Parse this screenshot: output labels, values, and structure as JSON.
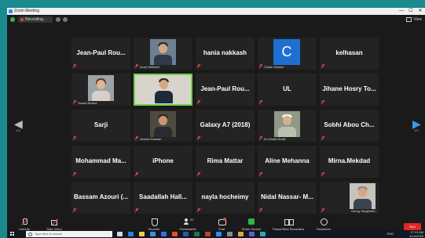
{
  "window": {
    "title": "Zoom Meeting",
    "controls": [
      "—",
      "☐",
      "✕"
    ]
  },
  "topbar": {
    "recording_label": "Recording...",
    "view_label": "View"
  },
  "pagination": {
    "left": "1/2",
    "right": "1/2"
  },
  "tiles": [
    {
      "name": "Jean-Paul Rou...",
      "mic_muted": true
    },
    {
      "name": "",
      "sub_label": "Imad Hbtbeiht",
      "type": "photo",
      "mic_muted": true
    },
    {
      "name": "hania nakkash",
      "mic_muted": true
    },
    {
      "name": "",
      "sub_label": "Chafic Mokbel",
      "type": "avatar",
      "avatar_letter": "C",
      "avatar_color": "#1f6fd1",
      "mic_muted": true
    },
    {
      "name": "kelhasan",
      "mic_muted": true
    },
    {
      "name": "",
      "sub_label": "Souad Nouna",
      "type": "photo",
      "mic_muted": true
    },
    {
      "name": "",
      "sub_label": "Ibra Dahan",
      "type": "photo",
      "active_speaker": true,
      "mic_muted": false
    },
    {
      "name": "Jean-Paul Rou...",
      "mic_muted": true
    },
    {
      "name": "UL",
      "mic_muted": true
    },
    {
      "name": "Jihane Hosry To...",
      "mic_muted": true
    },
    {
      "name": "Sarji",
      "mic_muted": true
    },
    {
      "name": "",
      "sub_label": "Ahmad Sankari",
      "type": "photo",
      "mic_muted": true
    },
    {
      "name": "Galaxy A7 (2018)",
      "mic_muted": true
    },
    {
      "name": "",
      "sub_label": "Dr Khalid Khalil",
      "type": "photo",
      "mic_muted": true
    },
    {
      "name": "Sobhi Abou Ch...",
      "mic_muted": true
    },
    {
      "name": "Mohammad Ma...",
      "mic_muted": true
    },
    {
      "name": "iPhone",
      "mic_muted": true
    },
    {
      "name": "Rima Mattar",
      "mic_muted": true
    },
    {
      "name": "Aline Mehanna",
      "mic_muted": true
    },
    {
      "name": "Mirna.Mekdad",
      "mic_muted": true
    },
    {
      "name": "Bassam Azouri (...",
      "mic_muted": true
    },
    {
      "name": "Saadallah Hall...",
      "mic_muted": true
    },
    {
      "name": "nayla hocheimy",
      "mic_muted": true
    },
    {
      "name": "Nidal Nassar- M...",
      "mic_muted": true
    },
    {
      "name": "",
      "sub_label": "Georg Sarghmito...",
      "type": "photo",
      "mic_muted": true
    }
  ],
  "toolbar": {
    "unmute": "Unmute",
    "start_video": "Start Video",
    "security": "Security",
    "participants": "Participants",
    "participants_count": "22",
    "chat": "Chat",
    "share_screen": "Share Screen",
    "pause_recording": "Pause/Stop Recording",
    "reactions": "Reactions",
    "end": "End"
  },
  "taskbar": {
    "search_placeholder": "Type here to search",
    "time": "17:15 AM",
    "date": "4/14/2020",
    "lang": "ENG"
  }
}
